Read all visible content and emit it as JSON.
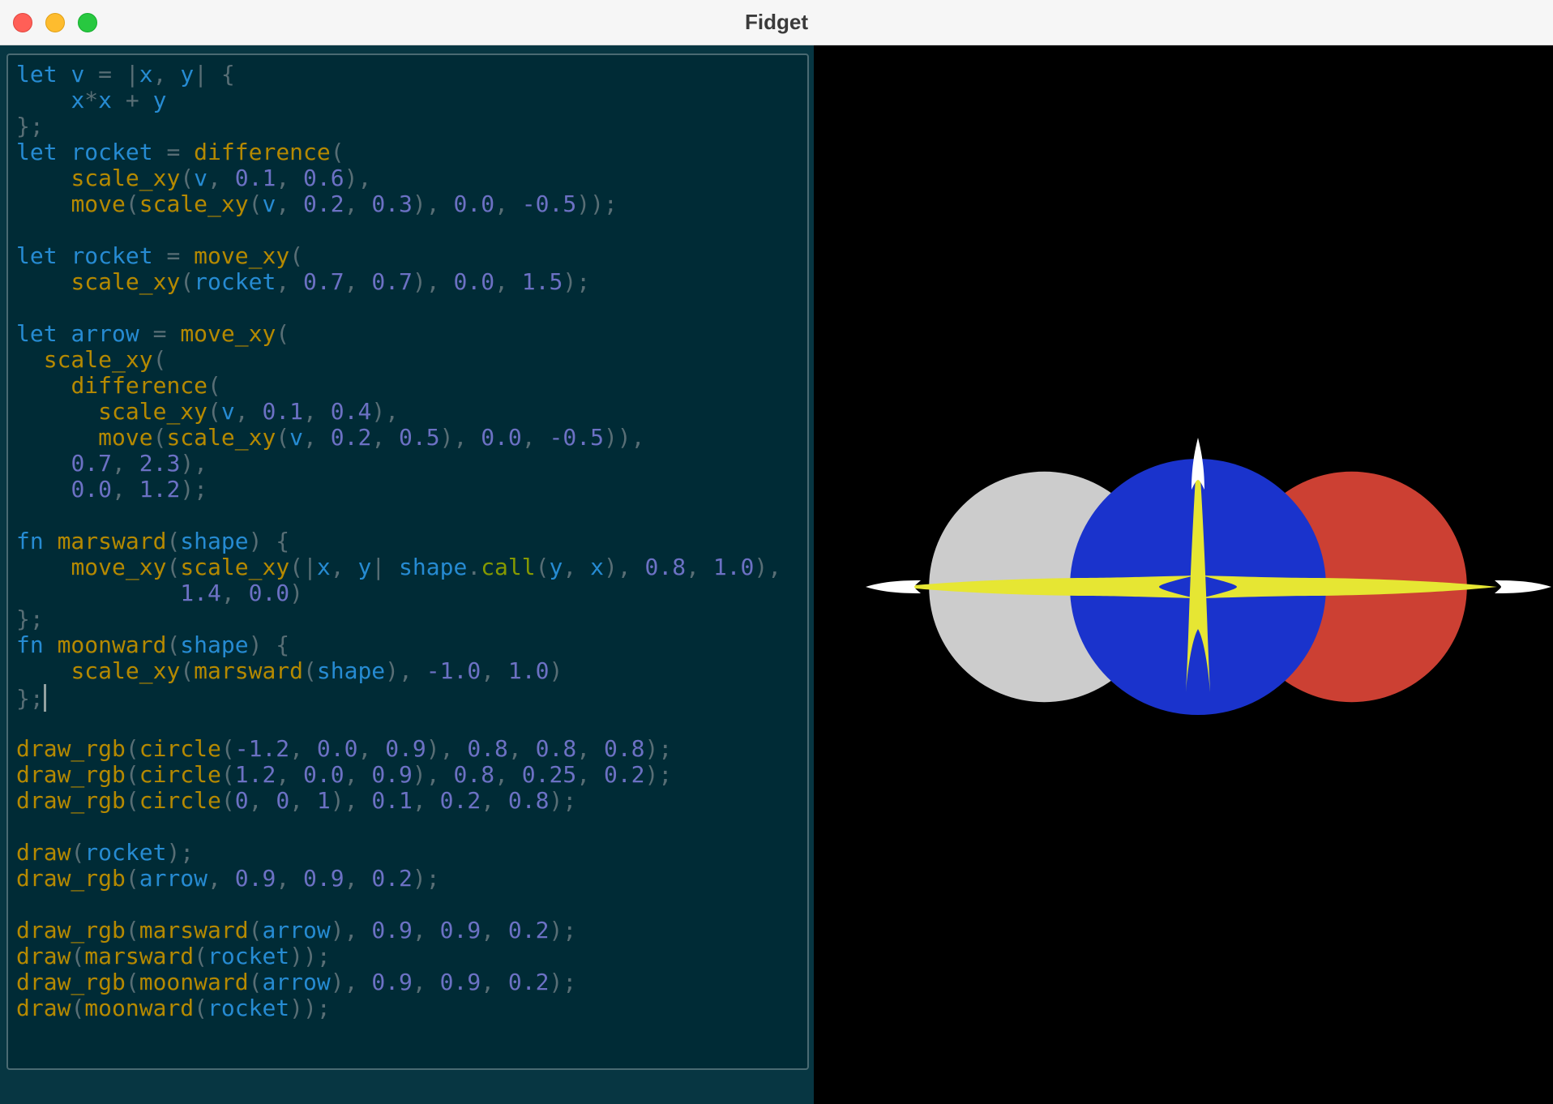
{
  "window": {
    "title": "Fidget",
    "buttons": [
      "close",
      "minimize",
      "zoom"
    ]
  },
  "editor": {
    "lines": [
      [
        [
          "kw",
          "let "
        ],
        [
          "id",
          "v"
        ],
        [
          "pun",
          " = |"
        ],
        [
          "id",
          "x"
        ],
        [
          "pun",
          ", "
        ],
        [
          "id",
          "y"
        ],
        [
          "pun",
          "| {"
        ]
      ],
      [
        [
          "pun",
          "    "
        ],
        [
          "id",
          "x"
        ],
        [
          "pun",
          "*"
        ],
        [
          "id",
          "x"
        ],
        [
          "pun",
          " + "
        ],
        [
          "id",
          "y"
        ]
      ],
      [
        [
          "pun",
          "};"
        ]
      ],
      [
        [
          "kw",
          "let "
        ],
        [
          "id",
          "rocket"
        ],
        [
          "pun",
          " = "
        ],
        [
          "fnc",
          "difference"
        ],
        [
          "pun",
          "("
        ]
      ],
      [
        [
          "pun",
          "    "
        ],
        [
          "fnc",
          "scale_xy"
        ],
        [
          "pun",
          "("
        ],
        [
          "id",
          "v"
        ],
        [
          "pun",
          ", "
        ],
        [
          "num",
          "0.1"
        ],
        [
          "pun",
          ", "
        ],
        [
          "num",
          "0.6"
        ],
        [
          "pun",
          "),"
        ]
      ],
      [
        [
          "pun",
          "    "
        ],
        [
          "fnc",
          "move"
        ],
        [
          "pun",
          "("
        ],
        [
          "fnc",
          "scale_xy"
        ],
        [
          "pun",
          "("
        ],
        [
          "id",
          "v"
        ],
        [
          "pun",
          ", "
        ],
        [
          "num",
          "0.2"
        ],
        [
          "pun",
          ", "
        ],
        [
          "num",
          "0.3"
        ],
        [
          "pun",
          "), "
        ],
        [
          "num",
          "0.0"
        ],
        [
          "pun",
          ", "
        ],
        [
          "num",
          "-0.5"
        ],
        [
          "pun",
          "));"
        ]
      ],
      [],
      [
        [
          "kw",
          "let "
        ],
        [
          "id",
          "rocket"
        ],
        [
          "pun",
          " = "
        ],
        [
          "fnc",
          "move_xy"
        ],
        [
          "pun",
          "("
        ]
      ],
      [
        [
          "pun",
          "    "
        ],
        [
          "fnc",
          "scale_xy"
        ],
        [
          "pun",
          "("
        ],
        [
          "id",
          "rocket"
        ],
        [
          "pun",
          ", "
        ],
        [
          "num",
          "0.7"
        ],
        [
          "pun",
          ", "
        ],
        [
          "num",
          "0.7"
        ],
        [
          "pun",
          "), "
        ],
        [
          "num",
          "0.0"
        ],
        [
          "pun",
          ", "
        ],
        [
          "num",
          "1.5"
        ],
        [
          "pun",
          ");"
        ]
      ],
      [],
      [
        [
          "kw",
          "let "
        ],
        [
          "id",
          "arrow"
        ],
        [
          "pun",
          " = "
        ],
        [
          "fnc",
          "move_xy"
        ],
        [
          "pun",
          "("
        ]
      ],
      [
        [
          "pun",
          "  "
        ],
        [
          "fnc",
          "scale_xy"
        ],
        [
          "pun",
          "("
        ]
      ],
      [
        [
          "pun",
          "    "
        ],
        [
          "fnc",
          "difference"
        ],
        [
          "pun",
          "("
        ]
      ],
      [
        [
          "pun",
          "      "
        ],
        [
          "fnc",
          "scale_xy"
        ],
        [
          "pun",
          "("
        ],
        [
          "id",
          "v"
        ],
        [
          "pun",
          ", "
        ],
        [
          "num",
          "0.1"
        ],
        [
          "pun",
          ", "
        ],
        [
          "num",
          "0.4"
        ],
        [
          "pun",
          "),"
        ]
      ],
      [
        [
          "pun",
          "      "
        ],
        [
          "fnc",
          "move"
        ],
        [
          "pun",
          "("
        ],
        [
          "fnc",
          "scale_xy"
        ],
        [
          "pun",
          "("
        ],
        [
          "id",
          "v"
        ],
        [
          "pun",
          ", "
        ],
        [
          "num",
          "0.2"
        ],
        [
          "pun",
          ", "
        ],
        [
          "num",
          "0.5"
        ],
        [
          "pun",
          "), "
        ],
        [
          "num",
          "0.0"
        ],
        [
          "pun",
          ", "
        ],
        [
          "num",
          "-0.5"
        ],
        [
          "pun",
          ")),"
        ]
      ],
      [
        [
          "pun",
          "    "
        ],
        [
          "num",
          "0.7"
        ],
        [
          "pun",
          ", "
        ],
        [
          "num",
          "2.3"
        ],
        [
          "pun",
          "),"
        ]
      ],
      [
        [
          "pun",
          "    "
        ],
        [
          "num",
          "0.0"
        ],
        [
          "pun",
          ", "
        ],
        [
          "num",
          "1.2"
        ],
        [
          "pun",
          ");"
        ]
      ],
      [],
      [
        [
          "kw",
          "fn "
        ],
        [
          "fnc",
          "marsward"
        ],
        [
          "pun",
          "("
        ],
        [
          "id",
          "shape"
        ],
        [
          "pun",
          ") {"
        ]
      ],
      [
        [
          "pun",
          "    "
        ],
        [
          "fnc",
          "move_xy"
        ],
        [
          "pun",
          "("
        ],
        [
          "fnc",
          "scale_xy"
        ],
        [
          "pun",
          "(|"
        ],
        [
          "id",
          "x"
        ],
        [
          "pun",
          ", "
        ],
        [
          "id",
          "y"
        ],
        [
          "pun",
          "| "
        ],
        [
          "id",
          "shape"
        ],
        [
          "pun",
          "."
        ],
        [
          "mth",
          "call"
        ],
        [
          "pun",
          "("
        ],
        [
          "id",
          "y"
        ],
        [
          "pun",
          ", "
        ],
        [
          "id",
          "x"
        ],
        [
          "pun",
          "), "
        ],
        [
          "num",
          "0.8"
        ],
        [
          "pun",
          ", "
        ],
        [
          "num",
          "1.0"
        ],
        [
          "pun",
          "),"
        ]
      ],
      [
        [
          "pun",
          "            "
        ],
        [
          "num",
          "1.4"
        ],
        [
          "pun",
          ", "
        ],
        [
          "num",
          "0.0"
        ],
        [
          "pun",
          ")"
        ]
      ],
      [
        [
          "pun",
          "};"
        ]
      ],
      [
        [
          "kw",
          "fn "
        ],
        [
          "fnc",
          "moonward"
        ],
        [
          "pun",
          "("
        ],
        [
          "id",
          "shape"
        ],
        [
          "pun",
          ") {"
        ]
      ],
      [
        [
          "pun",
          "    "
        ],
        [
          "fnc",
          "scale_xy"
        ],
        [
          "pun",
          "("
        ],
        [
          "fnc",
          "marsward"
        ],
        [
          "pun",
          "("
        ],
        [
          "id",
          "shape"
        ],
        [
          "pun",
          "), "
        ],
        [
          "num",
          "-1.0"
        ],
        [
          "pun",
          ", "
        ],
        [
          "num",
          "1.0"
        ],
        [
          "pun",
          ")"
        ]
      ],
      [
        [
          "pun",
          "};"
        ],
        [
          "cursor",
          ""
        ]
      ],
      [],
      [
        [
          "fnc",
          "draw_rgb"
        ],
        [
          "pun",
          "("
        ],
        [
          "fnc",
          "circle"
        ],
        [
          "pun",
          "("
        ],
        [
          "num",
          "-1.2"
        ],
        [
          "pun",
          ", "
        ],
        [
          "num",
          "0.0"
        ],
        [
          "pun",
          ", "
        ],
        [
          "num",
          "0.9"
        ],
        [
          "pun",
          "), "
        ],
        [
          "num",
          "0.8"
        ],
        [
          "pun",
          ", "
        ],
        [
          "num",
          "0.8"
        ],
        [
          "pun",
          ", "
        ],
        [
          "num",
          "0.8"
        ],
        [
          "pun",
          ");"
        ]
      ],
      [
        [
          "fnc",
          "draw_rgb"
        ],
        [
          "pun",
          "("
        ],
        [
          "fnc",
          "circle"
        ],
        [
          "pun",
          "("
        ],
        [
          "num",
          "1.2"
        ],
        [
          "pun",
          ", "
        ],
        [
          "num",
          "0.0"
        ],
        [
          "pun",
          ", "
        ],
        [
          "num",
          "0.9"
        ],
        [
          "pun",
          "), "
        ],
        [
          "num",
          "0.8"
        ],
        [
          "pun",
          ", "
        ],
        [
          "num",
          "0.25"
        ],
        [
          "pun",
          ", "
        ],
        [
          "num",
          "0.2"
        ],
        [
          "pun",
          ");"
        ]
      ],
      [
        [
          "fnc",
          "draw_rgb"
        ],
        [
          "pun",
          "("
        ],
        [
          "fnc",
          "circle"
        ],
        [
          "pun",
          "("
        ],
        [
          "num",
          "0"
        ],
        [
          "pun",
          ", "
        ],
        [
          "num",
          "0"
        ],
        [
          "pun",
          ", "
        ],
        [
          "num",
          "1"
        ],
        [
          "pun",
          "), "
        ],
        [
          "num",
          "0.1"
        ],
        [
          "pun",
          ", "
        ],
        [
          "num",
          "0.2"
        ],
        [
          "pun",
          ", "
        ],
        [
          "num",
          "0.8"
        ],
        [
          "pun",
          ");"
        ]
      ],
      [],
      [
        [
          "fnc",
          "draw"
        ],
        [
          "pun",
          "("
        ],
        [
          "id",
          "rocket"
        ],
        [
          "pun",
          ");"
        ]
      ],
      [
        [
          "fnc",
          "draw_rgb"
        ],
        [
          "pun",
          "("
        ],
        [
          "id",
          "arrow"
        ],
        [
          "pun",
          ", "
        ],
        [
          "num",
          "0.9"
        ],
        [
          "pun",
          ", "
        ],
        [
          "num",
          "0.9"
        ],
        [
          "pun",
          ", "
        ],
        [
          "num",
          "0.2"
        ],
        [
          "pun",
          ");"
        ]
      ],
      [],
      [
        [
          "fnc",
          "draw_rgb"
        ],
        [
          "pun",
          "("
        ],
        [
          "fnc",
          "marsward"
        ],
        [
          "pun",
          "("
        ],
        [
          "id",
          "arrow"
        ],
        [
          "pun",
          "), "
        ],
        [
          "num",
          "0.9"
        ],
        [
          "pun",
          ", "
        ],
        [
          "num",
          "0.9"
        ],
        [
          "pun",
          ", "
        ],
        [
          "num",
          "0.2"
        ],
        [
          "pun",
          ");"
        ]
      ],
      [
        [
          "fnc",
          "draw"
        ],
        [
          "pun",
          "("
        ],
        [
          "fnc",
          "marsward"
        ],
        [
          "pun",
          "("
        ],
        [
          "id",
          "rocket"
        ],
        [
          "pun",
          "));"
        ]
      ],
      [
        [
          "fnc",
          "draw_rgb"
        ],
        [
          "pun",
          "("
        ],
        [
          "fnc",
          "moonward"
        ],
        [
          "pun",
          "("
        ],
        [
          "id",
          "arrow"
        ],
        [
          "pun",
          "), "
        ],
        [
          "num",
          "0.9"
        ],
        [
          "pun",
          ", "
        ],
        [
          "num",
          "0.9"
        ],
        [
          "pun",
          ", "
        ],
        [
          "num",
          "0.2"
        ],
        [
          "pun",
          ");"
        ]
      ],
      [
        [
          "fnc",
          "draw"
        ],
        [
          "pun",
          "("
        ],
        [
          "fnc",
          "moonward"
        ],
        [
          "pun",
          "("
        ],
        [
          "id",
          "rocket"
        ],
        [
          "pun",
          "));"
        ]
      ]
    ]
  },
  "colors": {
    "keyword": "#268bd2",
    "identifier": "#268bd2",
    "function": "#b58900",
    "method": "#859900",
    "number": "#6c71c4",
    "punctuation": "#586e75",
    "editor_background": "#002b36",
    "render_background": "#000000",
    "moon_circle": "#cccccc",
    "mars_circle": "#cc4033",
    "earth_circle": "#1a33cc",
    "arrow": "#e6e633",
    "rocket": "#ffffff"
  },
  "render": {
    "circles": [
      {
        "name": "moon-circle",
        "cx": -1.2,
        "cy": 0.0,
        "r": 0.9,
        "rgb": [
          0.8,
          0.8,
          0.8
        ]
      },
      {
        "name": "mars-circle",
        "cx": 1.2,
        "cy": 0.0,
        "r": 0.9,
        "rgb": [
          0.8,
          0.25,
          0.2
        ]
      },
      {
        "name": "earth-circle",
        "cx": 0,
        "cy": 0,
        "r": 1,
        "rgb": [
          0.1,
          0.2,
          0.8
        ]
      }
    ]
  }
}
